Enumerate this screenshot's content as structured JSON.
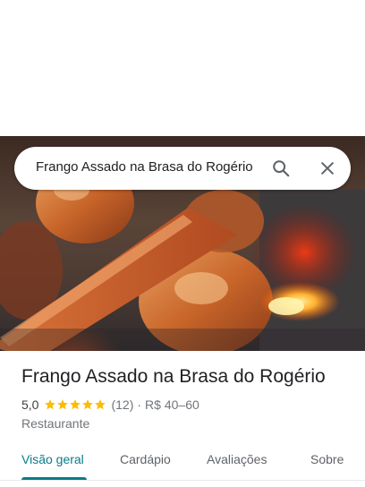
{
  "search": {
    "query": "Frango Assado na Brasa do Rogério",
    "search_icon": "search-icon",
    "close_icon": "close-icon"
  },
  "hero": {
    "description_icon": "place-photo"
  },
  "place": {
    "title": "Frango Assado na Brasa do Rogério",
    "rating": "5,0",
    "stars": 5,
    "reviews": "(12)",
    "separator": "·",
    "price": "R$ 40–60",
    "category": "Restaurante"
  },
  "tabs": [
    {
      "label": "Visão geral",
      "active": true
    },
    {
      "label": "Cardápio",
      "active": false
    },
    {
      "label": "Avaliações",
      "active": false
    },
    {
      "label": "Sobre",
      "active": false
    }
  ],
  "colors": {
    "accent": "#0a7c86",
    "star": "#fbbc04",
    "text_primary": "#202124",
    "text_secondary": "#70757a"
  }
}
